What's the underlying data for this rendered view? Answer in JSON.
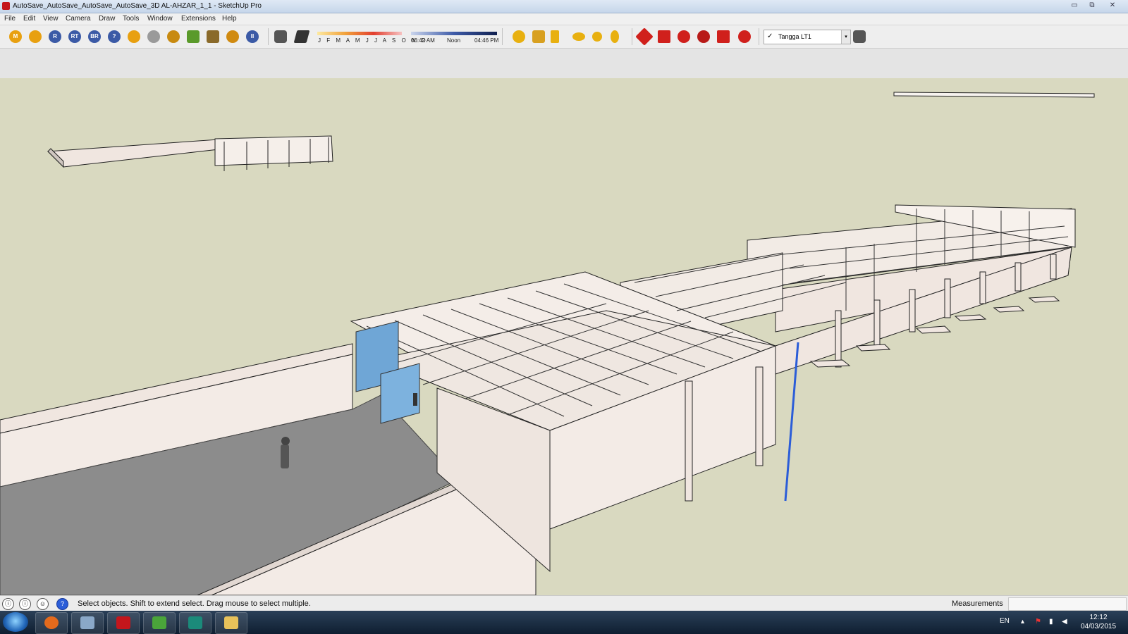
{
  "window": {
    "title": "AutoSave_AutoSave_AutoSave_AutoSave_3D AL-AHZAR_1_1 - SketchUp Pro",
    "buttons": {
      "minimize": "▭",
      "restore": "⧉",
      "close": "✕"
    }
  },
  "menu": {
    "items": [
      "File",
      "Edit",
      "View",
      "Camera",
      "Draw",
      "Tools",
      "Window",
      "Extensions",
      "Help"
    ]
  },
  "toolbar": {
    "plugin_icons": [
      {
        "label": "M",
        "icon": "plugin-m-icon",
        "color": "#e8a010"
      },
      {
        "label": "",
        "icon": "tag-icon",
        "color": "#e8a010"
      },
      {
        "label": "R",
        "icon": "plugin-r-icon",
        "color": "#3b5aa6"
      },
      {
        "label": "RT",
        "icon": "plugin-rt-icon",
        "color": "#3b5aa6"
      },
      {
        "label": "BR",
        "icon": "plugin-br-icon",
        "color": "#3b5aa6"
      },
      {
        "label": "?",
        "icon": "help-icon",
        "color": "#3b5aa6"
      },
      {
        "label": "",
        "icon": "tag2-icon",
        "color": "#e8a010"
      },
      {
        "label": "",
        "icon": "sphere-icon",
        "color": "#9a9a9a"
      },
      {
        "label": "",
        "icon": "light-icon",
        "color": "#c88a10"
      },
      {
        "label": "",
        "icon": "tree-icon",
        "color": "#5a9a2a"
      },
      {
        "label": "",
        "icon": "tree2-icon",
        "color": "#8a6a2a"
      },
      {
        "label": "",
        "icon": "target-icon",
        "color": "#d08a10"
      },
      {
        "label": "II",
        "icon": "pause-icon",
        "color": "#3b5aa6"
      }
    ],
    "shadows": {
      "months": "J F M A M J J A S O N D",
      "time_start": "06:42 AM",
      "time_mid": "Noon",
      "time_end": "04:46 PM"
    },
    "sun_icons": [
      {
        "icon": "sun-icon",
        "color": "#e8b010"
      },
      {
        "icon": "sun-up-icon",
        "color": "#d8a020"
      },
      {
        "icon": "sun-flag-icon",
        "color": "#e8b010"
      },
      {
        "icon": "sun-half-icon",
        "color": "#e8b010"
      },
      {
        "icon": "sun-dot-icon",
        "color": "#e8b010"
      },
      {
        "icon": "sun-key-icon",
        "color": "#e8b010"
      }
    ],
    "edit_icons": [
      {
        "icon": "move-icon",
        "color": "#d0201c"
      },
      {
        "icon": "push-pull-icon",
        "color": "#d0201c"
      },
      {
        "icon": "rotate-icon",
        "color": "#d0201c"
      },
      {
        "icon": "follow-me-icon",
        "color": "#d0201c"
      },
      {
        "icon": "scale-icon",
        "color": "#d0201c"
      },
      {
        "icon": "offset-icon",
        "color": "#d0201c"
      }
    ],
    "layer": {
      "check": "✓",
      "name": "Tangga LT1",
      "dropdown": "▾"
    }
  },
  "statusbar": {
    "message": "Select objects. Shift to extend select. Drag mouse to select multiple.",
    "measurements_label": "Measurements",
    "measurements_value": "",
    "icons": [
      "ⓘ",
      "ⓘ",
      "☺",
      "?"
    ]
  },
  "taskbar": {
    "apps": [
      {
        "name": "firefox",
        "color": "#e46a1c"
      },
      {
        "name": "calculator",
        "color": "#8aa8c8"
      },
      {
        "name": "sketchup",
        "color": "#c4161c"
      },
      {
        "name": "leaf-app",
        "color": "#4aa53a"
      },
      {
        "name": "autocad-app",
        "color": "#1b8a7a"
      },
      {
        "name": "explorer",
        "color": "#e8c25a"
      }
    ],
    "language": "EN",
    "time": "12:12",
    "date": "04/03/2015"
  },
  "colors": {
    "sky": "#d9d9c0",
    "wall": "#f0e6e0",
    "ground": "#8c8c8c",
    "glass": "#6fa6d6",
    "axis_blue": "#2b5dd8"
  }
}
